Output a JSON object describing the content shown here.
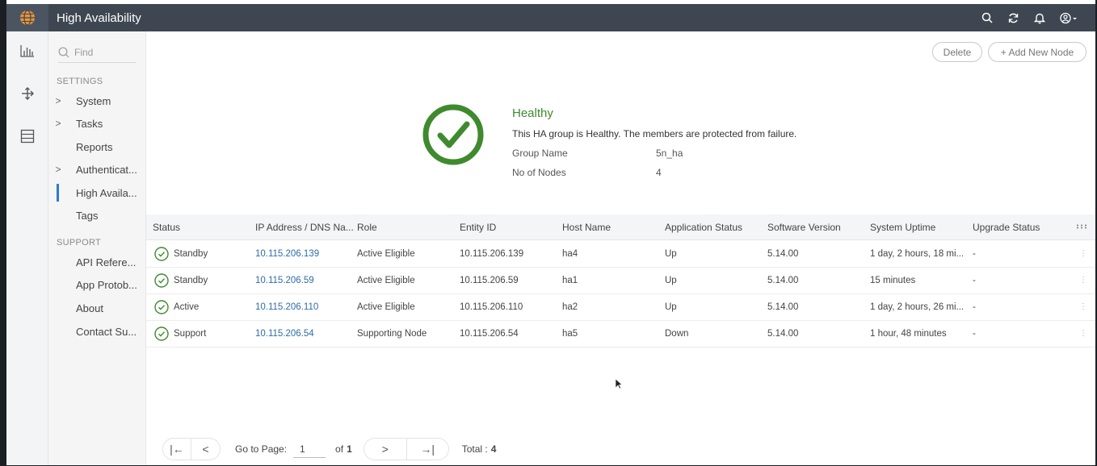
{
  "header": {
    "title": "High Availability"
  },
  "sidebar": {
    "find_placeholder": "Find",
    "settings_label": "SETTINGS",
    "support_label": "SUPPORT",
    "items": [
      {
        "label": "System",
        "chevron": ">"
      },
      {
        "label": "Tasks",
        "chevron": ">"
      },
      {
        "label": "Reports",
        "chevron": ""
      },
      {
        "label": "Authenticat...",
        "chevron": ">"
      },
      {
        "label": "High Availa...",
        "chevron": ""
      },
      {
        "label": "Tags",
        "chevron": ""
      }
    ],
    "support_items": [
      {
        "label": "API Refere..."
      },
      {
        "label": "App Protob..."
      },
      {
        "label": "About"
      },
      {
        "label": "Contact Su..."
      }
    ]
  },
  "toolbar": {
    "delete_label": "Delete",
    "add_label": "+ Add New Node"
  },
  "health": {
    "title": "Healthy",
    "message": "This HA group is Healthy. The members are protected from failure.",
    "group_name_label": "Group Name",
    "group_name_value": "5n_ha",
    "nodes_label": "No of Nodes",
    "nodes_value": "4",
    "color": "#3f8a2e"
  },
  "table": {
    "columns": [
      "Status",
      "IP Address / DNS Na...",
      "Role",
      "Entity ID",
      "Host Name",
      "Application Status",
      "Software Version",
      "System Uptime",
      "Upgrade Status"
    ],
    "rows": [
      {
        "status": "Standby",
        "ip": "10.115.206.139",
        "role": "Active Eligible",
        "entity": "10.115.206.139",
        "host": "ha4",
        "app": "Up",
        "sw": "5.14.00",
        "uptime": "1 day, 2 hours, 18 mi...",
        "upgrade": "-"
      },
      {
        "status": "Standby",
        "ip": "10.115.206.59",
        "role": "Active Eligible",
        "entity": "10.115.206.59",
        "host": "ha1",
        "app": "Up",
        "sw": "5.14.00",
        "uptime": "15 minutes",
        "upgrade": "-"
      },
      {
        "status": "Active",
        "ip": "10.115.206.110",
        "role": "Active Eligible",
        "entity": "10.115.206.110",
        "host": "ha2",
        "app": "Up",
        "sw": "5.14.00",
        "uptime": "1 day, 2 hours, 26 mi...",
        "upgrade": "-"
      },
      {
        "status": "Support",
        "ip": "10.115.206.54",
        "role": "Supporting Node",
        "entity": "10.115.206.54",
        "host": "ha5",
        "app": "Down",
        "sw": "5.14.00",
        "uptime": "1 hour, 48 minutes",
        "upgrade": "-"
      }
    ]
  },
  "pager": {
    "first": "|←",
    "prev": "<",
    "goto_label": "Go to Page:",
    "page": "1",
    "of_label": "of",
    "of_total": "1",
    "next": ">",
    "last": "→|",
    "total_label": "Total :",
    "total_value": "4"
  }
}
